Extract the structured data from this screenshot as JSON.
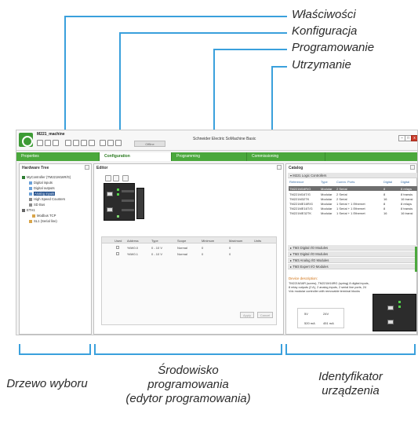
{
  "callouts_top": [
    "Właściwości",
    "Konfiguracja",
    "Programowanie",
    "Utrzymanie"
  ],
  "callouts_bottom": {
    "tree": "Drzewo wyboru",
    "editor_line1": "Środowisko",
    "editor_line2": "programowania",
    "editor_line3": "(edytor programowania)",
    "device_line1": "Identyfikator",
    "device_line2": "urządzenia"
  },
  "colors": {
    "accent_line": "#3aa0dc",
    "tab_bar": "#4aa83c"
  },
  "app": {
    "project_name": "M221_machine",
    "title": "Schneider Electric SoMachine Basic",
    "offline_label": "Offline"
  },
  "tabs": [
    {
      "label": "Properties",
      "active": false
    },
    {
      "label": "Configuration",
      "active": true
    },
    {
      "label": "Programming",
      "active": false
    },
    {
      "label": "Commissioning",
      "active": false
    }
  ],
  "hardware_tree": {
    "title": "Hardware Tree",
    "items": [
      {
        "label": "MyController  (TM221M16R/G)",
        "icon": "controller-icon"
      },
      {
        "label": "Digital inputs",
        "icon": "io-icon"
      },
      {
        "label": "Digital outputs",
        "icon": "io-icon"
      },
      {
        "label": "Analog inputs",
        "icon": "io-icon",
        "selected": true
      },
      {
        "label": "High Speed Counters",
        "icon": "counter-icon"
      },
      {
        "label": "SD Bus",
        "icon": "bus-icon"
      },
      {
        "label": "ETH1",
        "icon": "ethernet-icon"
      },
      {
        "label": "Modbus TCP",
        "icon": "folder-icon"
      },
      {
        "label": "SL1 (Serial line)",
        "icon": "serial-icon"
      }
    ]
  },
  "editor": {
    "title": "Editor",
    "table_headers": [
      "Used",
      "Address",
      "Type",
      "Scope",
      "Minimum",
      "Maximum",
      "Units"
    ],
    "rows": [
      {
        "address": "%IW0.0",
        "type": "0 - 10 V",
        "scope": "Normal",
        "minimum": "0",
        "maximum": "0"
      },
      {
        "address": "%IW0.1",
        "type": "0 - 10 V",
        "scope": "Normal",
        "minimum": "0",
        "maximum": "0"
      }
    ],
    "apply_label": "Apply",
    "cancel_label": "Cancel"
  },
  "catalog": {
    "title": "Catalog",
    "group_main": "M221 Logic Controllers",
    "headers": [
      "Reference",
      "Type",
      "Comm. Ports",
      "Digital",
      "Digital"
    ],
    "rows": [
      [
        "TM221M16R/G",
        "Modular",
        "2 Serial",
        "8",
        "8 relays"
      ],
      [
        "TM221M16T/G",
        "Modular",
        "2 Serial",
        "8",
        "8 transis"
      ],
      [
        "TM221M32TK",
        "Modular",
        "2 Serial",
        "16",
        "16 transi"
      ],
      [
        "TM221ME16R/G",
        "Modular",
        "1 Serial + 1 Ethernet",
        "8",
        "8 relays"
      ],
      [
        "TM221ME16T/G",
        "Modular",
        "1 Serial + 1 Ethernet",
        "8",
        "8 transis"
      ],
      [
        "TM221ME32TK",
        "Modular",
        "1 Serial + 1 Ethernet",
        "16",
        "16 transi"
      ]
    ],
    "groups": [
      "TM3 Digital I/O Modules",
      "TM2 Digital I/O Modules",
      "TM3 Analog I/O Modules",
      "TM3 Expert I/O Modules"
    ],
    "desc_title": "Device description:",
    "desc_text": "TM221M16R (screw), TM221M16RG (spring) 8 digital inputs, 8 relay outputs (2 A), 2 analog inputs, 2 serial line ports, 24 Vdc modular controller with removable terminal blocks",
    "power_headers": [
      "5V",
      "24V"
    ],
    "power_values": [
      "520 mA",
      "451 mA"
    ]
  }
}
